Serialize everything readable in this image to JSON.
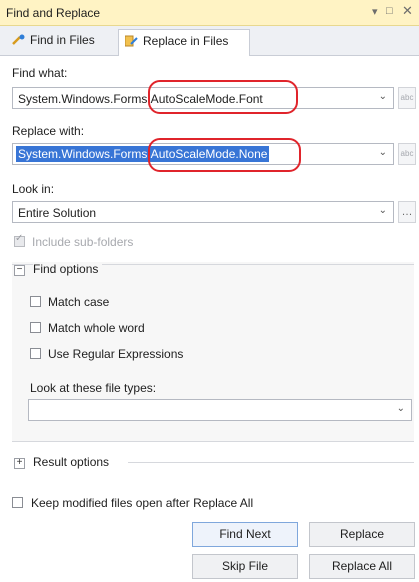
{
  "window": {
    "title": "Find and Replace",
    "pin_icon": "dropdown-pin-icon",
    "maximize_icon": "maximize-icon",
    "close_icon": "close-icon"
  },
  "tabs": [
    {
      "label": "Find in Files",
      "icon": "find-in-files-icon",
      "active": false
    },
    {
      "label": "Replace in Files",
      "icon": "replace-in-files-icon",
      "active": true
    }
  ],
  "find_what": {
    "label": "Find what:",
    "value": "System.Windows.Forms.AutoScaleMode.Font"
  },
  "replace_with": {
    "label": "Replace with:",
    "value": "System.Windows.Forms.AutoScaleMode.None"
  },
  "look_in": {
    "label": "Look in:",
    "value": "Entire Solution"
  },
  "include_subfolders": {
    "label": "Include sub-folders",
    "checked": true,
    "enabled": false
  },
  "find_options": {
    "header": "Find options",
    "match_case": {
      "label": "Match case",
      "checked": false
    },
    "match_whole_word": {
      "label": "Match whole word",
      "checked": false
    },
    "use_regex": {
      "label": "Use Regular Expressions",
      "checked": false
    },
    "file_types_label": "Look at these file types:",
    "file_types_value": ""
  },
  "result_options": {
    "header": "Result options"
  },
  "keep_modified": {
    "label": "Keep modified files open after Replace All",
    "checked": false
  },
  "buttons": {
    "find_next": "Find Next",
    "replace": "Replace",
    "skip_file": "Skip File",
    "replace_all": "Replace All"
  },
  "colors": {
    "title_bar": "#fff3c4",
    "selection": "#3875d6",
    "annotation_ring": "#e0242b"
  }
}
